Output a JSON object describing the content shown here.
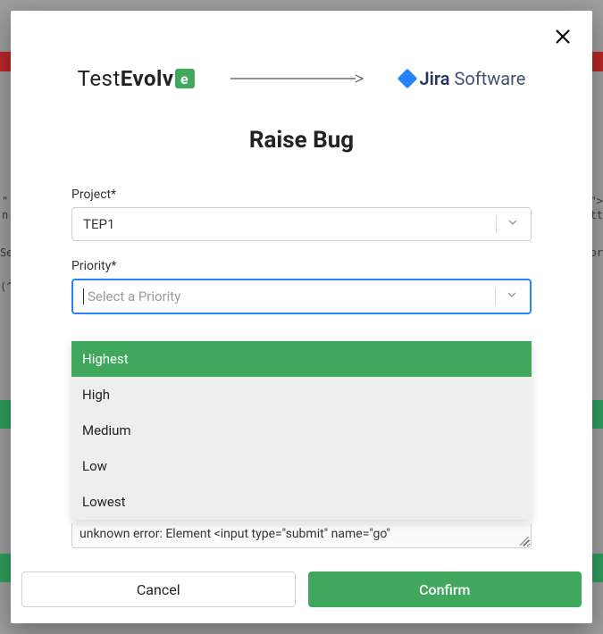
{
  "brand": {
    "testevolve_prefix": "Test",
    "testevolve_bold": "Evolv",
    "testevolve_badge": "e",
    "jira_name": "Jira",
    "jira_soft": " Software"
  },
  "title": "Raise Bug",
  "project": {
    "label": "Project*",
    "value": "TEP1"
  },
  "priority": {
    "label": "Priority*",
    "placeholder": "Select a Priority",
    "options": [
      "Highest",
      "High",
      "Medium",
      "Low",
      "Lowest"
    ],
    "highlight_index": 0
  },
  "description_peek": "unknown error: Element <input type=\"submit\" name=\"go\"",
  "buttons": {
    "cancel": "Cancel",
    "confirm": "Confirm"
  },
  "bg": {
    "left1": "\"",
    "left2": "n",
    "left3": "Se",
    "left4": "(^",
    "right1": "l\">",
    "right2": "itt",
    "right3": "ror"
  }
}
